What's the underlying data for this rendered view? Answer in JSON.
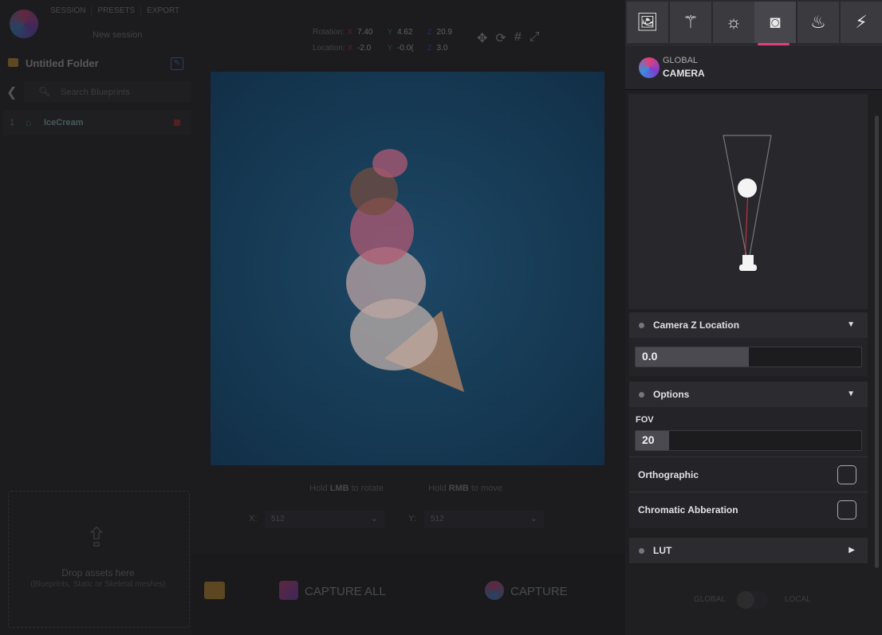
{
  "topmenu": {
    "items": [
      "SESSION",
      "PRESETS",
      "EXPORT"
    ],
    "session_name": "New session"
  },
  "folder": {
    "title": "Untitled Folder"
  },
  "search": {
    "placeholder": "Search Blueprints"
  },
  "list": {
    "items": [
      {
        "num": "1",
        "name": "IceCream"
      }
    ]
  },
  "drop": {
    "title": "Drop assets here",
    "subtitle": "(Blueprints, Static or Skeletal meshes)"
  },
  "coords": {
    "rotation": {
      "label": "Rotation:",
      "x": "7.40",
      "y": "4.62",
      "z": "20.9"
    },
    "location": {
      "label": "Location:",
      "x": "-2.0",
      "y": "-0.0(",
      "z": "3.0"
    },
    "axes": {
      "x": "X",
      "y": "Y",
      "z": "Z"
    }
  },
  "hint": {
    "prefix1": "Hold ",
    "key1": "LMB",
    "suffix1": " to rotate",
    "prefix2": "Hold ",
    "key2": "RMB",
    "suffix2": " to move"
  },
  "resolution": {
    "x_label": "X:",
    "x_value": "512",
    "y_label": "Y:",
    "y_value": "512"
  },
  "bottom": {
    "capture_all": "CAPTURE ALL",
    "capture": "CAPTURE"
  },
  "panel": {
    "header_sub": "GLOBAL",
    "header_title": "CAMERA",
    "sections": {
      "camera_z": {
        "label": "Camera Z Location",
        "value": "0.0",
        "fill": 0.5
      },
      "options": {
        "label": "Options",
        "fov_label": "FOV",
        "fov_value": "20",
        "fov_fill": 0.15,
        "orthographic": "Orthographic",
        "chromatic": "Chromatic Abberation"
      },
      "lut": {
        "label": "LUT"
      }
    },
    "toggle": {
      "global": "GLOBAL",
      "local": "LOCAL"
    }
  },
  "colors": {
    "accent": "#e0407a",
    "viewport_bg": "#164566",
    "folder": "#d69a2c"
  }
}
